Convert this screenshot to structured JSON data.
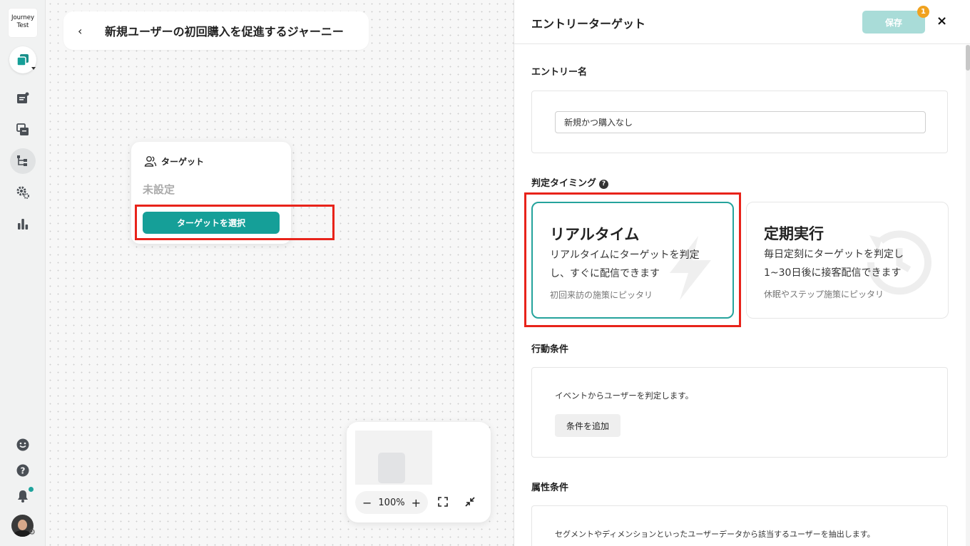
{
  "app": {
    "logo_text_line1": "Journey",
    "logo_text_line2": "Test"
  },
  "sidebar": {
    "items": [
      {
        "name": "sidebar-item-campaign",
        "icon": "card-icon"
      },
      {
        "name": "sidebar-item-templates",
        "icon": "layers-icon"
      },
      {
        "name": "sidebar-item-journey",
        "icon": "flow-icon",
        "active": true
      },
      {
        "name": "sidebar-item-settings",
        "icon": "gear-icon"
      },
      {
        "name": "sidebar-item-analytics",
        "icon": "bar-chart-icon"
      }
    ],
    "bottom": [
      "smile-icon",
      "help-icon",
      "bell-icon",
      "avatar"
    ]
  },
  "canvas": {
    "journey_title": "新規ユーザーの初回購入を促進するジャーニー",
    "target_node": {
      "header": "ターゲット",
      "status": "未設定",
      "select_button": "ターゲットを選択"
    },
    "minimap": {
      "zoom_level": "100%",
      "zoom_out": "−",
      "zoom_in": "+"
    }
  },
  "panel": {
    "title": "エントリーターゲット",
    "save_label": "保存",
    "save_badge": "1",
    "close_label": "×",
    "entry_name": {
      "label": "エントリー名",
      "value": "新規かつ購入なし"
    },
    "timing": {
      "label": "判定タイミング",
      "options": [
        {
          "title": "リアルタイム",
          "desc_line1": "リアルタイムにターゲットを判定",
          "desc_line2": "し、すぐに配信できます",
          "note": "初回来訪の施策にピッタリ",
          "selected": true
        },
        {
          "title": "定期実行",
          "desc_line1": "毎日定刻にターゲットを判定し",
          "desc_line2": "1~30日後に接客配信できます",
          "note": "休眠やステップ施策にピッタリ",
          "selected": false
        }
      ]
    },
    "behavior": {
      "label": "行動条件",
      "description": "イベントからユーザーを判定します。",
      "add_button": "条件を追加"
    },
    "attribute": {
      "label": "属性条件",
      "description": "セグメントやディメンションといったユーザーデータから該当するユーザーを抽出します。"
    }
  },
  "colors": {
    "accent": "#159f98",
    "highlight": "#e8231a",
    "badge": "#f0a21f",
    "save_disabled": "#a9dcd8"
  }
}
